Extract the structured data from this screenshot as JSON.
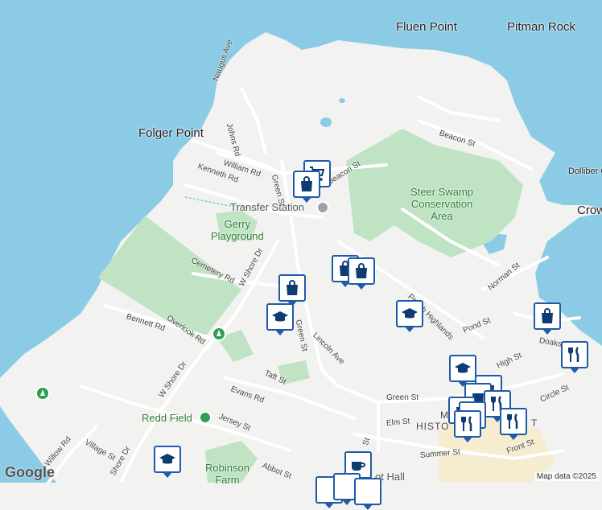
{
  "map": {
    "places": [
      {
        "id": "fluen-point",
        "text": "Fluen Point"
      },
      {
        "id": "pitman-rock",
        "text": "Pitman Rock"
      },
      {
        "id": "folger-point",
        "text": "Folger Point"
      },
      {
        "id": "crow",
        "text": "Crow"
      },
      {
        "id": "dolliber",
        "text": "Dolliber C"
      }
    ],
    "green_areas": {
      "steer_swamp": "Steer Swamp\nConservation\nArea",
      "gerry_playground": "Gerry\nPlayground",
      "redd_field": "Redd Field",
      "robinson_farm": "Robinson\nFarm"
    },
    "pois": {
      "transfer_station": "Transfer Station",
      "old_hall": "ot Hall"
    },
    "streets": [
      {
        "id": "naugus-ave",
        "text": "Naugus Ave"
      },
      {
        "id": "johns-rd",
        "text": "Johns Rd"
      },
      {
        "id": "william-rd",
        "text": "William Rd"
      },
      {
        "id": "kenneth-rd",
        "text": "Kenneth Rd"
      },
      {
        "id": "green-st-north",
        "text": "Green St"
      },
      {
        "id": "beacon-st-west",
        "text": "Beacon St"
      },
      {
        "id": "beacon-st-east",
        "text": "Beacon St"
      },
      {
        "id": "cemetery-rd",
        "text": "Cemetery Rd"
      },
      {
        "id": "w-shore-dr-north",
        "text": "W Shore Dr"
      },
      {
        "id": "green-st-mid",
        "text": "Green St"
      },
      {
        "id": "lincoln-ave",
        "text": "Lincoln Ave"
      },
      {
        "id": "bennett-rd",
        "text": "Bennett Rd"
      },
      {
        "id": "overlook-rd",
        "text": "Overlook Rd"
      },
      {
        "id": "taft-st",
        "text": "Taft St"
      },
      {
        "id": "evans-rd",
        "text": "Evans Rd"
      },
      {
        "id": "w-shore-dr-south",
        "text": "W Shore Dr"
      },
      {
        "id": "jersey-st",
        "text": "Jersey St"
      },
      {
        "id": "green-st-east",
        "text": "Green St"
      },
      {
        "id": "elm-st",
        "text": "Elm St"
      },
      {
        "id": "willow-rd",
        "text": "Willow Rd"
      },
      {
        "id": "village-st",
        "text": "Village St"
      },
      {
        "id": "shore-dr-sw",
        "text": "Shore Dr"
      },
      {
        "id": "abbot-st",
        "text": "Abbot St"
      },
      {
        "id": "summer-st",
        "text": "Summer St"
      },
      {
        "id": "front-st",
        "text": "Front St"
      },
      {
        "id": "circle-st",
        "text": "Circle St"
      },
      {
        "id": "high-st",
        "text": "High St"
      },
      {
        "id": "doaks-ln",
        "text": "Doaks Ln"
      },
      {
        "id": "pond-st",
        "text": "Pond St"
      },
      {
        "id": "norman-st",
        "text": "Norman St"
      },
      {
        "id": "peach-highlands",
        "text": "Peach Highlands"
      },
      {
        "id": "st-south",
        "text": "St"
      },
      {
        "id": "histo",
        "text": "HISTO"
      },
      {
        "id": "hist-t",
        "text": "T"
      },
      {
        "id": "m-label",
        "text": "M"
      }
    ],
    "markers": [
      {
        "id": "marker-cart",
        "icon": "shopping-cart-icon"
      },
      {
        "id": "marker-bag-1",
        "icon": "shopping-bag-icon"
      },
      {
        "id": "marker-bag-2",
        "icon": "shopping-bag-icon"
      },
      {
        "id": "marker-bag-3",
        "icon": "shopping-bag-icon"
      },
      {
        "id": "marker-bag-4",
        "icon": "shopping-bag-icon"
      },
      {
        "id": "marker-bag-5",
        "icon": "shopping-bag-icon"
      },
      {
        "id": "marker-school-1",
        "icon": "graduation-cap-icon"
      },
      {
        "id": "marker-school-2",
        "icon": "graduation-cap-icon"
      },
      {
        "id": "marker-school-3",
        "icon": "graduation-cap-icon"
      },
      {
        "id": "marker-school-4",
        "icon": "graduation-cap-icon"
      },
      {
        "id": "marker-restaurant-1",
        "icon": "fork-knife-icon"
      },
      {
        "id": "marker-restaurant-2",
        "icon": "fork-knife-icon"
      },
      {
        "id": "marker-restaurant-3",
        "icon": "fork-knife-icon"
      },
      {
        "id": "marker-restaurant-4",
        "icon": "fork-knife-icon"
      },
      {
        "id": "marker-cafe",
        "icon": "coffee-cup-icon"
      }
    ],
    "colors": {
      "water": "#8ccbe6",
      "land": "#f2f2f0",
      "park": "#bfe3c3",
      "road": "#ffffff",
      "marker_border": "#1e5aa8",
      "marker_icon": "#0d3c73"
    }
  },
  "attribution": {
    "logo": "Google",
    "data": "Map data ©2025"
  }
}
